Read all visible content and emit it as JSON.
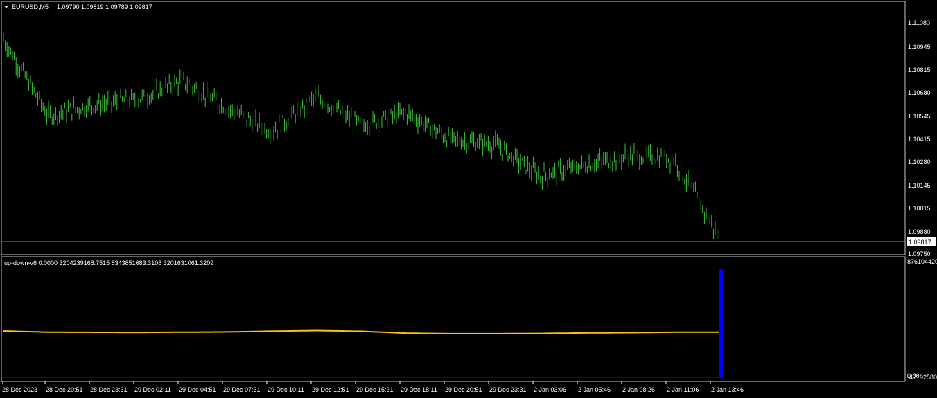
{
  "main_chart": {
    "header": {
      "dropdown_icon": "triangle-down-icon",
      "symbol_timeframe": "EURUSD,M5",
      "ohlc": "1.09790 1.09819 1.09789 1.09817"
    },
    "price_ticks": [
      "1.11080",
      "1.10945",
      "1.10815",
      "1.10680",
      "1.10545",
      "1.10415",
      "1.10280",
      "1.10145",
      "1.10015",
      "1.09880",
      "1.09750"
    ],
    "current_price_label": "1.09817",
    "colors": {
      "background": "#000000",
      "bars": "#3cc23c",
      "grid_border": "#c8c8c8",
      "price_line": "#708090",
      "price_label_bg": "#ffffff"
    }
  },
  "indicator_panel": {
    "header": "up-down-v6 0.0000 3204239168.7515 8343851683.3108 3201631061.3209",
    "scale_top": "876104420",
    "scale_bottom": "-47192580",
    "scale_zero": "0.00",
    "colors": {
      "line": "#ffc107",
      "histogram": "#0000ff",
      "baseline": "#0000ff"
    }
  },
  "time_axis": {
    "ticks": [
      "28 Dec 2023",
      "28 Dec 20:51",
      "28 Dec 23:31",
      "29 Dec 02:11",
      "29 Dec 04:51",
      "29 Dec 07:31",
      "29 Dec 10:11",
      "29 Dec 12:51",
      "29 Dec 15:31",
      "29 Dec 18:11",
      "29 Dec 20:51",
      "29 Dec 23:31",
      "2 Jan 03:06",
      "2 Jan 05:46",
      "2 Jan 08:26",
      "2 Jan 11:06",
      "2 Jan 13:46"
    ]
  },
  "chart_data": {
    "type": "line",
    "price": {
      "name": "EURUSD,M5",
      "x": [
        "28 Dec 2023",
        "28 Dec 20:51",
        "28 Dec 23:31",
        "29 Dec 02:11",
        "29 Dec 04:51",
        "29 Dec 07:31",
        "29 Dec 10:11",
        "29 Dec 12:51",
        "29 Dec 15:31",
        "29 Dec 18:11",
        "29 Dec 20:51",
        "29 Dec 23:31",
        "2 Jan 03:06",
        "2 Jan 05:46",
        "2 Jan 08:26",
        "2 Jan 11:06",
        "2 Jan 13:46"
      ],
      "values": [
        1.1106,
        1.1058,
        1.1065,
        1.1068,
        1.108,
        1.1063,
        1.1048,
        1.107,
        1.1052,
        1.106,
        1.1043,
        1.104,
        1.102,
        1.1027,
        1.1033,
        1.1031,
        1.09817
      ],
      "ylim": [
        1.0975,
        1.1122
      ]
    },
    "indicator": {
      "name": "up-down-v6",
      "x": [
        "28 Dec 2023",
        "28 Dec 20:51",
        "28 Dec 23:31",
        "29 Dec 02:11",
        "29 Dec 04:51",
        "29 Dec 07:31",
        "29 Dec 10:11",
        "29 Dec 12:51",
        "29 Dec 15:31",
        "29 Dec 18:11",
        "29 Dec 20:51",
        "29 Dec 23:31",
        "2 Jan 03:06",
        "2 Jan 05:46",
        "2 Jan 08:26",
        "2 Jan 11:06",
        "2 Jan 13:46"
      ],
      "values": [
        330000000.0,
        320000000.0,
        319000000.0,
        318000000.0,
        320000000.0,
        322000000.0,
        328000000.0,
        333000000.0,
        327000000.0,
        312000000.0,
        308000000.0,
        308000000.0,
        310000000.0,
        314000000.0,
        316000000.0,
        320000000.0,
        320000000.0
      ],
      "histogram_last": 830000000.0,
      "ylim": [
        -47192580,
        876104420
      ]
    }
  }
}
